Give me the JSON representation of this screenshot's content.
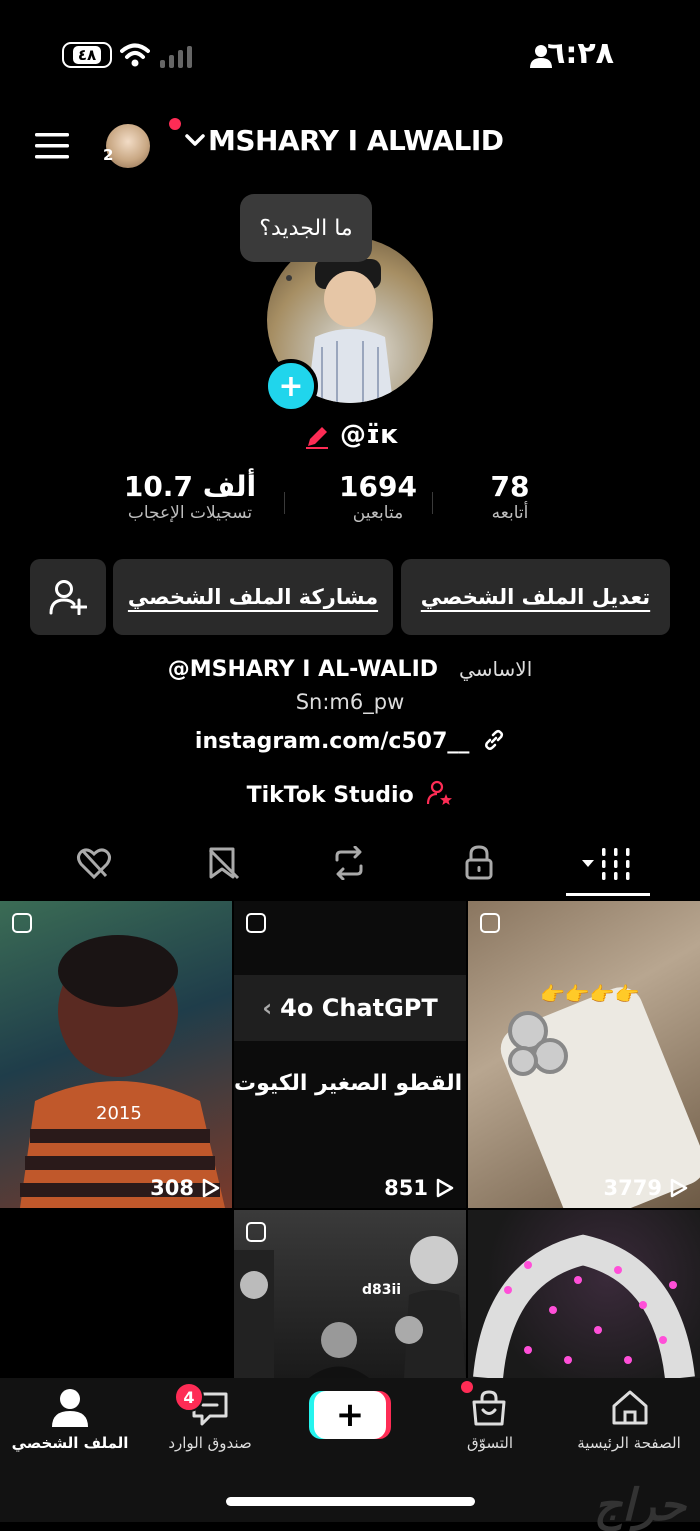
{
  "status_bar": {
    "time": "٦:٢٨",
    "battery": "٤٨"
  },
  "header": {
    "username": "MSHARY I ALWALID",
    "account_count": "2"
  },
  "profile": {
    "whats_new": "ما الجديد؟",
    "handle": "@ɪ̈ĸ",
    "stats": [
      {
        "value": "10.7 ألف",
        "label": "تسجيلات الإعجاب"
      },
      {
        "value": "1694",
        "label": "متابعين"
      },
      {
        "value": "78",
        "label": "أتابعه"
      }
    ],
    "buttons": {
      "edit": "تعديل الملف الشخصي",
      "share": "مشاركة الملف الشخصي"
    },
    "bio_line1_prefix": "الاساسي",
    "bio_line1": "@MSHARY I  AL-WALID",
    "bio_line2": "Sn:m6_pw",
    "link": "instagram.com/c507__",
    "studio": "TikTok Studio"
  },
  "grid": [
    {
      "views": "308",
      "overlay_text": "2015"
    },
    {
      "views": "851",
      "header": "4o ChatGPT",
      "overlay_text": "ع القطو الصغير الكيوت"
    },
    {
      "views": "3779"
    },
    {
      "views": ""
    },
    {
      "views": "",
      "overlay_text": "d83ii"
    },
    {
      "views": ""
    }
  ],
  "bottom_nav": {
    "home": "الصفحة الرئيسية",
    "shop": "التسوّق",
    "inbox": "صندوق الوارد",
    "inbox_badge": "4",
    "profile": "الملف الشخصي"
  },
  "watermark": "حراج",
  "colors": {
    "accent": "#fe2c55",
    "cyan": "#20d5ec",
    "button_bg": "#2a2a2a"
  }
}
